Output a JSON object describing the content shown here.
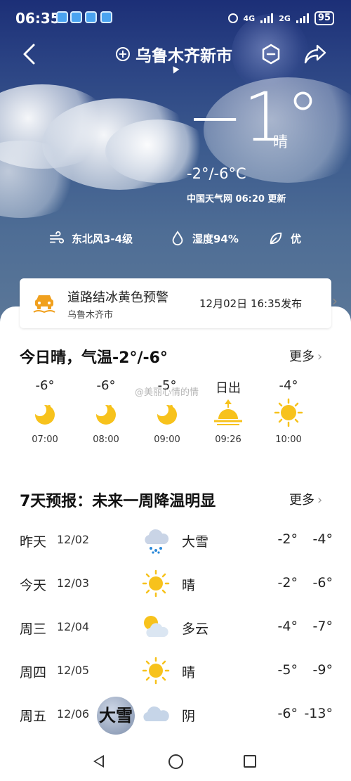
{
  "status_bar": {
    "time": "06:35",
    "network1": "4G",
    "network2": "2G",
    "battery": "95"
  },
  "header": {
    "city": "乌鲁木齐新市"
  },
  "current": {
    "temp": "−1°",
    "condition": "晴",
    "range": "-2°/-6°C",
    "update": "中国天气网 06:20 更新",
    "wind": "东北风3-4级",
    "humidity": "湿度94%",
    "air": "优"
  },
  "alert": {
    "title": "道路结冰黄色预警",
    "area": "乌鲁木齐市",
    "time": "12月02日 16:35发布"
  },
  "today": {
    "title": "今日晴，气温-2°/-6°",
    "more": "更多",
    "watermark": "@美丽心情的情",
    "hours": [
      {
        "temp": "-6°",
        "icon": "moon-icon",
        "time": "07:00"
      },
      {
        "temp": "-6°",
        "icon": "moon-icon",
        "time": "08:00"
      },
      {
        "temp": "-5°",
        "icon": "moon-icon",
        "time": "09:00"
      },
      {
        "temp": "日出",
        "icon": "sunrise-icon",
        "time": "09:26"
      },
      {
        "temp": "-4°",
        "icon": "sun-icon",
        "time": "10:00"
      }
    ]
  },
  "forecast": {
    "title": "7天预报：未来一周降温明显",
    "more": "更多",
    "days": [
      {
        "name": "昨天",
        "date": "12/02",
        "icon": "heavy-snow-icon",
        "cond": "大雪",
        "hi": "-2°",
        "lo": "-4°"
      },
      {
        "name": "今天",
        "date": "12/03",
        "icon": "sun-icon",
        "cond": "晴",
        "hi": "-2°",
        "lo": "-6°"
      },
      {
        "name": "周三",
        "date": "12/04",
        "icon": "partly-cloudy-icon",
        "cond": "多云",
        "hi": "-4°",
        "lo": "-7°"
      },
      {
        "name": "周四",
        "date": "12/05",
        "icon": "sun-icon",
        "cond": "晴",
        "hi": "-5°",
        "lo": "-9°"
      },
      {
        "name": "周五",
        "date": "12/06",
        "icon": "cloudy-icon",
        "cond": "阴",
        "hi": "-6°",
        "lo": "-13°"
      }
    ],
    "badge": "大雪"
  },
  "colors": {
    "sky_top": "#1c2f77",
    "sky_bottom": "#5c7898",
    "sun": "#f7c21c",
    "alert_yellow": "#f0a01e"
  }
}
